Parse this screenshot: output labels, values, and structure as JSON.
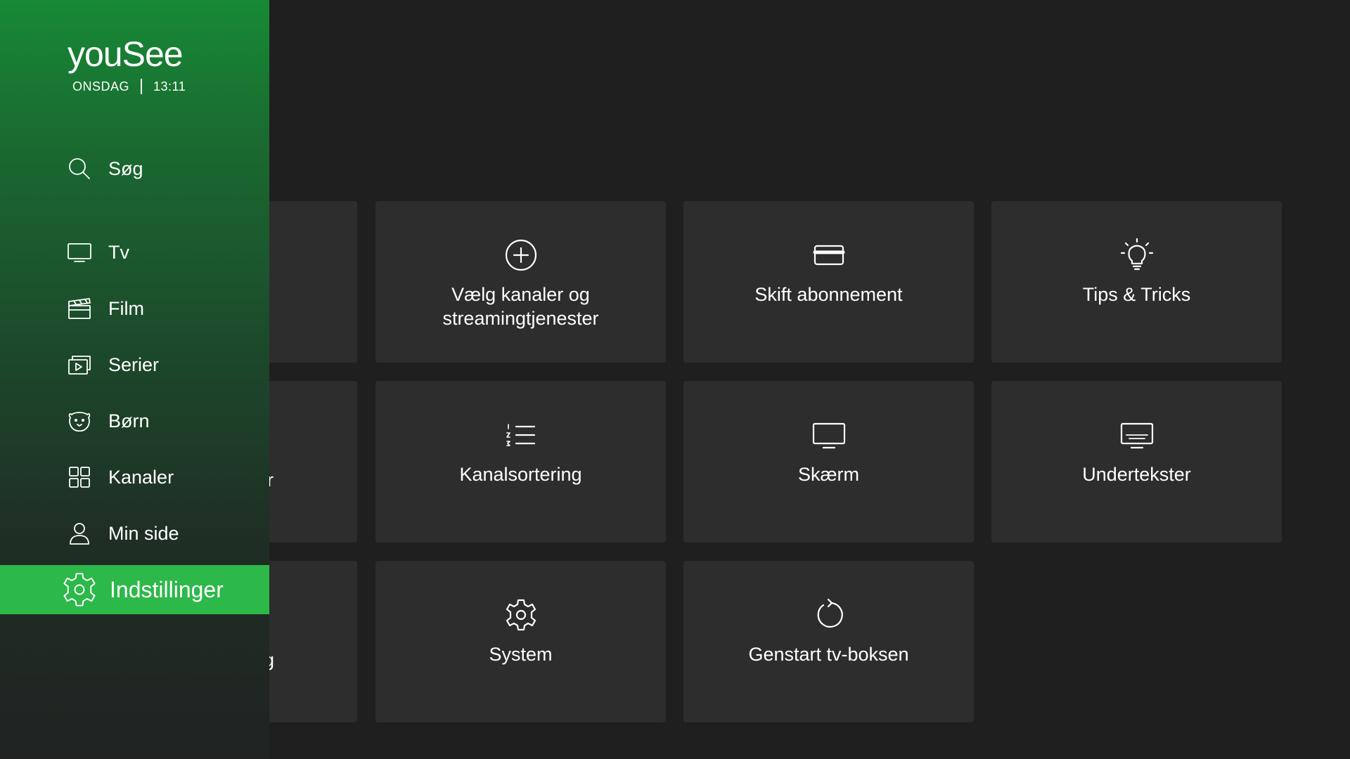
{
  "brand": {
    "logo": "youSee",
    "day": "ONSDAG",
    "time": "13:11"
  },
  "sidebar": {
    "items": [
      {
        "label": "Søg",
        "icon": "search-icon"
      },
      {
        "label": "Tv",
        "icon": "tv-icon"
      },
      {
        "label": "Film",
        "icon": "clapperboard-icon"
      },
      {
        "label": "Serier",
        "icon": "series-icon"
      },
      {
        "label": "Børn",
        "icon": "kids-bear-icon"
      },
      {
        "label": "Kanaler",
        "icon": "grid-icon"
      },
      {
        "label": "Min side",
        "icon": "user-icon"
      },
      {
        "label": "Indstillinger",
        "icon": "gear-icon",
        "active": true
      }
    ],
    "accent_color": "#2db84a"
  },
  "tiles": {
    "partial_row2_text": "r",
    "partial_row3_text": "g",
    "items": [
      {
        "label": "Vælg kanaler og\nstreamingtjenester",
        "icon": "plus-circle-icon"
      },
      {
        "label": "Skift abonnement",
        "icon": "credit-card-icon"
      },
      {
        "label": "Tips & Tricks",
        "icon": "lightbulb-icon"
      },
      {
        "label": "Kanalsortering",
        "icon": "numbered-list-icon"
      },
      {
        "label": "Skærm",
        "icon": "monitor-icon"
      },
      {
        "label": "Undertekster",
        "icon": "subtitles-icon"
      },
      {
        "label": "System",
        "icon": "gear-icon"
      },
      {
        "label": "Genstart tv-boksen",
        "icon": "restart-icon"
      }
    ]
  }
}
